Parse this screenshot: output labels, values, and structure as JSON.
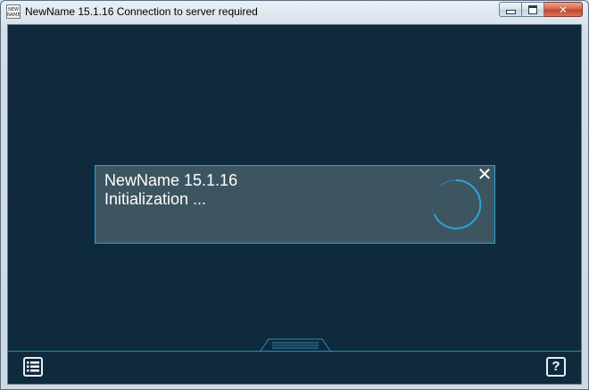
{
  "window": {
    "title": "NewName 15.1.16 Connection to server required",
    "icon_text_line1": "NEW",
    "icon_text_line2": "NAME",
    "icon_name": "app-icon",
    "controls": {
      "minimize_icon": "minimize-icon",
      "maximize_icon": "maximize-icon",
      "close_icon": "close-icon",
      "close_glyph": "✕"
    }
  },
  "dialog": {
    "title": "NewName 15.1.16",
    "status": "Initialization ...",
    "close_glyph": "✕",
    "spinner_icon": "loading-spinner-icon"
  },
  "footer": {
    "menu_icon": "list-menu-icon",
    "help_label": "?",
    "help_icon": "help-icon",
    "handle_icon": "panel-handle-icon"
  },
  "colors": {
    "background": "#0f2a3d",
    "accent": "#2ea3d4",
    "dialog_bg": "#3d5560",
    "text": "#ffffff"
  }
}
